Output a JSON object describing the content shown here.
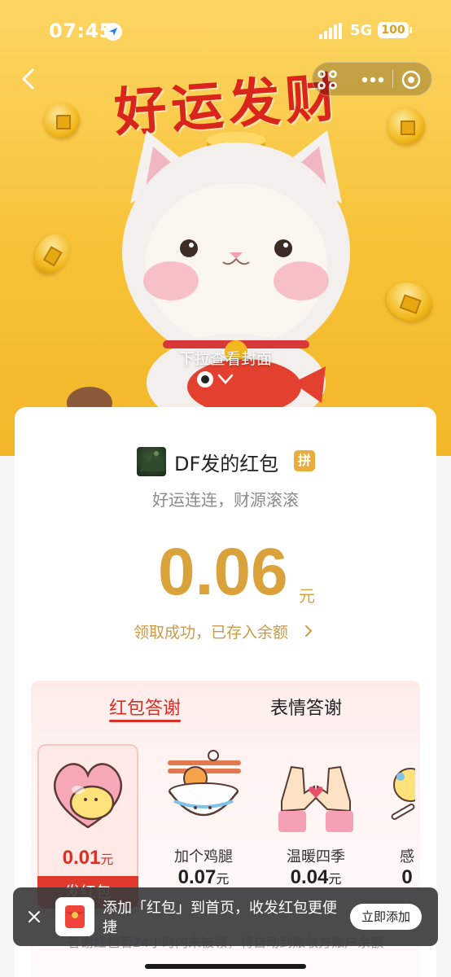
{
  "status_bar": {
    "time": "07:45",
    "network": "5G",
    "battery": "100",
    "location_icon": "location-arrow-icon",
    "signal_icon": "signal-bars-icon"
  },
  "nav": {
    "back_icon": "chevron-left-icon",
    "scan_icon": "scan-icon",
    "more_icon": "more-dots-icon",
    "close_icon": "target-circle-icon"
  },
  "cover": {
    "title": "好运发财",
    "pull_hint": "下拉查看封面"
  },
  "packet": {
    "sender": "DF发的红包",
    "badge": "拼",
    "blessing": "好运连连，财源滚滚",
    "amount": "0.06",
    "unit": "元",
    "status": "领取成功，已存入余额"
  },
  "thanks": {
    "tabs": [
      {
        "label": "红包答谢",
        "active": true
      },
      {
        "label": "表情答谢",
        "active": false
      }
    ],
    "stickers": [
      {
        "name": "",
        "price": "0.01",
        "unit": "元",
        "selected": true
      },
      {
        "name": "加个鸡腿",
        "price": "0.07",
        "unit": "元",
        "selected": false
      },
      {
        "name": "温暖四季",
        "price": "0.04",
        "unit": "元",
        "selected": false
      },
      {
        "name": "感",
        "price": "0",
        "unit": "",
        "selected": false
      }
    ],
    "send_label": "发红包"
  },
  "footer_note": "答谢红包若24小时内未被领，将自动到账收方账户余额",
  "toast": {
    "text": "添加「红包」到首页，收发红包更便捷",
    "button": "立即添加"
  },
  "colors": {
    "accent_red": "#d93025",
    "gold": "#d9a23a",
    "banner_yellow": "#f7c237"
  }
}
